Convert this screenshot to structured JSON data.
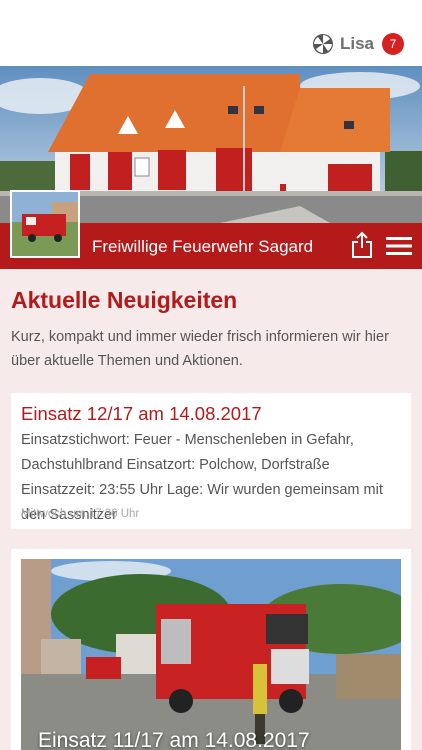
{
  "header": {
    "user_name": "Lisa",
    "notification_count": "7",
    "brand_icon": "pinwheel-logo-icon"
  },
  "station": {
    "name": "Freiwillige Feuerwehr Sagard",
    "share_icon": "share-icon",
    "menu_icon": "hamburger-menu-icon"
  },
  "news": {
    "section_title": "Aktuelle Neuigkeiten",
    "intro": "Kurz, kompakt und immer wieder frisch informieren wir hier über aktuelle Themen und Aktionen.",
    "items": [
      {
        "title": "Einsatz 12/17 am 14.08.2017",
        "body": "Einsatzstichwort: Feuer - Menschenleben in Gefahr, Dachstuhlbrand Einsatzort: Polchow, Dorfstraße Einsatzzeit: 23:55 Uhr Lage: Wir wurden gemeinsam mit den Sassnitzer",
        "time": "Mittwoch um 17:36 Uhr"
      },
      {
        "title": "Einsatz 11/17 am 14.08.2017"
      }
    ]
  },
  "colors": {
    "brand_red": "#b51a1a",
    "background": "#f7eaea",
    "badge_red": "#d42121"
  }
}
